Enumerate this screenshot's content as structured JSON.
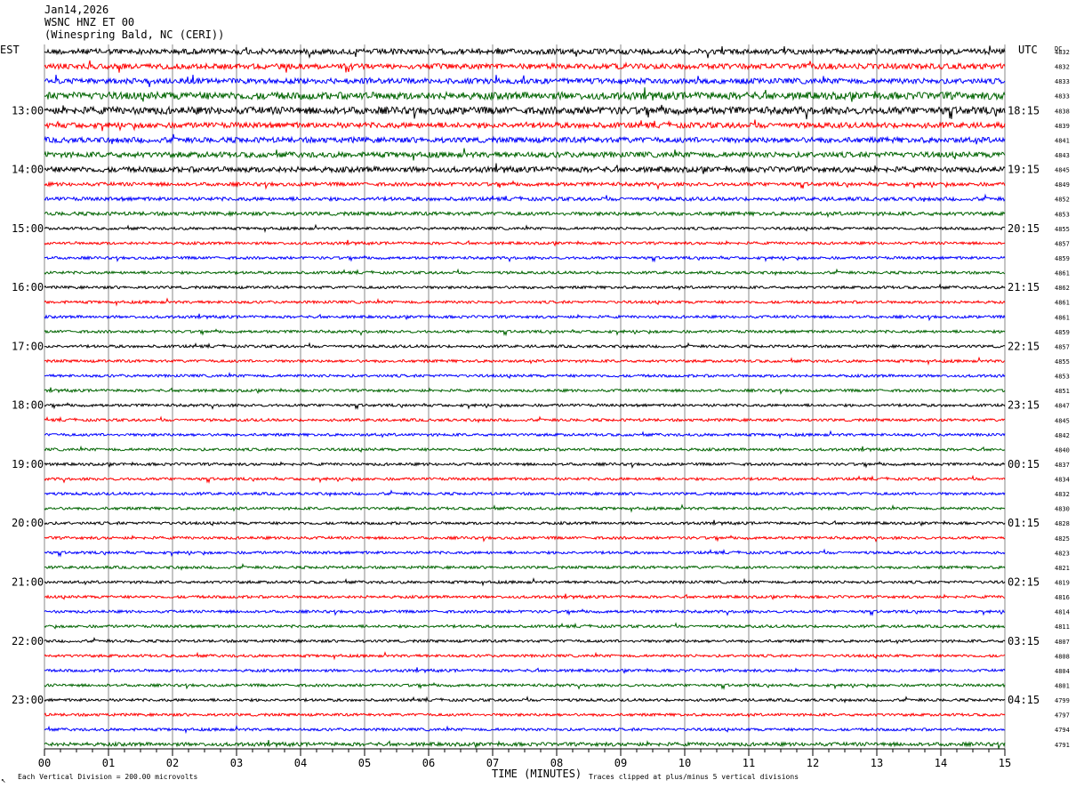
{
  "header": {
    "date": "Jan14,2026",
    "station": "WSNC HNZ ET 00",
    "location": "(Winespring Bald, NC (CERI))"
  },
  "chart_data": {
    "type": "line",
    "title": "",
    "left_axis_label": "EST",
    "right_axis_label": "UTC",
    "dc_label": "DC",
    "xlabel": "TIME (MINUTES)",
    "xlim": [
      0,
      15
    ],
    "x_ticks": [
      "00",
      "01",
      "02",
      "03",
      "04",
      "05",
      "06",
      "07",
      "08",
      "09",
      "10",
      "11",
      "12",
      "13",
      "14",
      "15"
    ],
    "left_hour_labels": [
      "13:00",
      "14:00",
      "15:00",
      "16:00",
      "17:00",
      "18:00",
      "19:00",
      "20:00",
      "21:00",
      "22:00",
      "23:00"
    ],
    "right_hour_labels": [
      "18:15",
      "19:15",
      "20:15",
      "21:15",
      "22:15",
      "23:15",
      "00:15",
      "01:15",
      "02:15",
      "03:15",
      "04:15"
    ],
    "trace_colors": [
      "#000000",
      "#ff0000",
      "#0000ff",
      "#006400"
    ],
    "trace_amplitude": [
      3,
      3,
      3,
      4,
      4,
      3,
      3,
      3,
      3,
      2,
      2,
      2,
      1.5,
      1.5,
      1.5,
      1.5,
      1.5,
      1.5,
      1.5,
      1.5,
      1.5,
      1.5,
      1.5,
      1.5,
      1.5,
      1.5,
      1.5,
      1.5,
      1.5,
      1.5,
      1.5,
      1.5,
      1.5,
      1.5,
      1.5,
      1.5,
      1.5,
      1.5,
      1.5,
      1.5,
      1.5,
      1.5,
      1.5,
      1.5,
      1.5,
      1.5,
      1.5,
      2,
      2.5,
      3.5,
      3.5,
      3,
      3,
      3,
      3,
      2,
      2,
      2,
      2,
      2,
      2,
      2
    ],
    "dc_values": [
      "4832",
      "4832",
      "4833",
      "4833",
      "4838",
      "4839",
      "4841",
      "4843",
      "4845",
      "4849",
      "4852",
      "4853",
      "4855",
      "4857",
      "4859",
      "4861",
      "4862",
      "4861",
      "4861",
      "4859",
      "4857",
      "4855",
      "4853",
      "4851",
      "4847",
      "4845",
      "4842",
      "4840",
      "4837",
      "4834",
      "4832",
      "4830",
      "4828",
      "4825",
      "4823",
      "4821",
      "4819",
      "4816",
      "4814",
      "4811",
      "4807",
      "4808",
      "4804",
      "4801",
      "4799",
      "4797",
      "4794",
      "4791"
    ],
    "footer_left": "Each Vertical Division =  200.00 microvolts",
    "footer_right": "Traces clipped at plus/minus 5 vertical divisions",
    "corner_mark": "↖"
  }
}
